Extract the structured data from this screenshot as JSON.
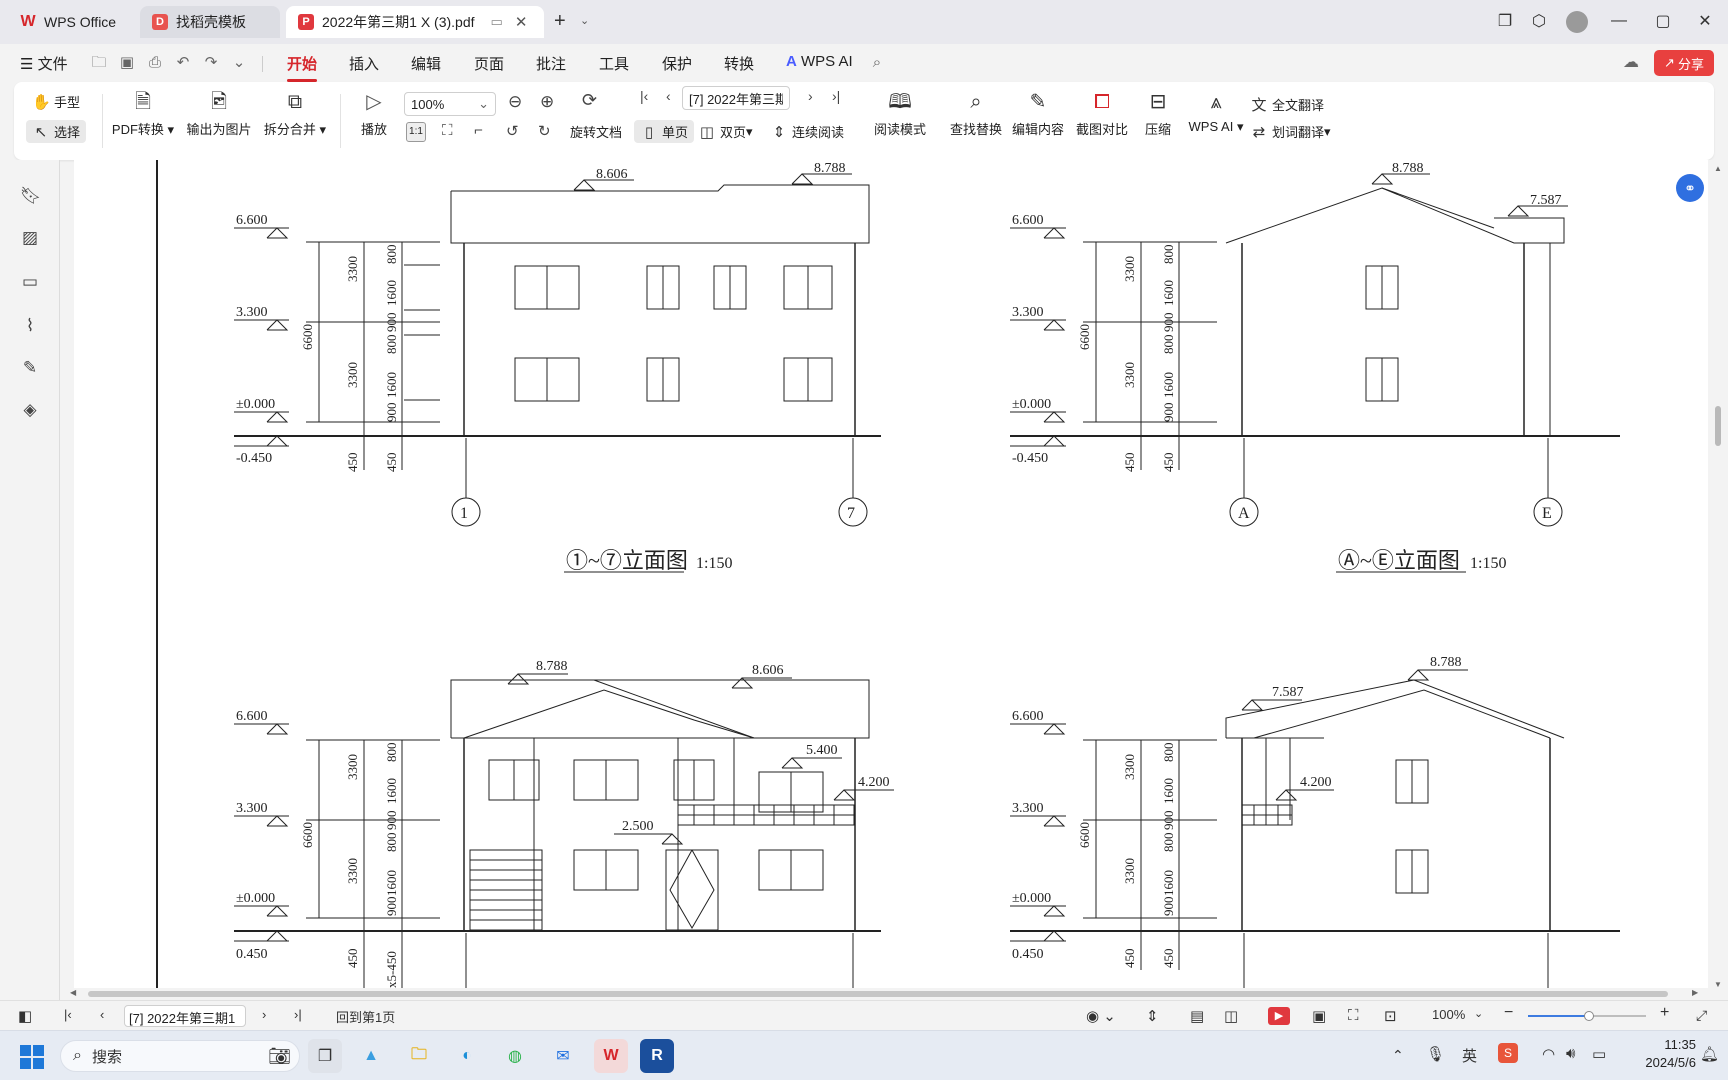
{
  "titlebar": {
    "tabs": [
      {
        "label": "WPS Office",
        "active": false
      },
      {
        "label": "找稻壳模板",
        "active": false
      },
      {
        "label": "2022年第三期1 X (3).pdf",
        "active": true
      }
    ],
    "new_tab": "+",
    "brand_color": "#d6262b"
  },
  "menubar": {
    "file": "文件",
    "items": [
      "开始",
      "插入",
      "编辑",
      "页面",
      "批注",
      "工具",
      "保护",
      "转换"
    ],
    "active": "开始",
    "wps_ai": "WPS AI",
    "share": "分享"
  },
  "ribbon": {
    "hand": "手型",
    "select": "选择",
    "pdf_convert": "PDF转换",
    "export_image": "输出为图片",
    "split_merge": "拆分合并",
    "play": "播放",
    "zoom": "100%",
    "page_field": "[7] 2022年第三期1",
    "rotate": "旋转文档",
    "single_page": "单页",
    "double_page": "双页",
    "continuous": "连续阅读",
    "reading_mode": "阅读模式",
    "find_replace": "查找替换",
    "edit_content": "编辑内容",
    "screenshot_compare": "截图对比",
    "compress": "压缩",
    "wps_ai": "WPS AI",
    "full_translate": "全文翻译",
    "word_translate": "划词翻译"
  },
  "drawing": {
    "tl": {
      "title": "①~⑦立面图",
      "scale": "1:150",
      "levels": [
        "6.600",
        "3.300",
        "±0.000",
        "-0.450"
      ],
      "tops": [
        "8.606",
        "8.788"
      ],
      "axis": [
        "1",
        "7"
      ],
      "dims": [
        "3300",
        "3300",
        "6600",
        "450",
        "450",
        "1600",
        "800",
        "1600",
        "900",
        "800",
        "900"
      ]
    },
    "tr": {
      "title": "Ⓐ~Ⓔ立面图",
      "scale": "1:150",
      "levels": [
        "6.600",
        "3.300",
        "±0.000",
        "-0.450"
      ],
      "tops": [
        "8.788",
        "7.587"
      ],
      "axis": [
        "A",
        "E"
      ],
      "dims": [
        "3300",
        "3300",
        "6600",
        "450",
        "450",
        "1600",
        "800",
        "1600",
        "900",
        "800",
        "900"
      ]
    },
    "bl": {
      "levels": [
        "6.600",
        "3.300",
        "±0.000",
        "0.450"
      ],
      "tops": [
        "8.788",
        "8.606"
      ],
      "marks": [
        "5.400",
        "4.200",
        "2.500"
      ],
      "dims": [
        "3300",
        "3300",
        "6600",
        "450",
        "1600",
        "800",
        "1600",
        "900",
        "800",
        "900",
        "x5-450"
      ]
    },
    "br": {
      "levels": [
        "6.600",
        "3.300",
        "±0.000",
        "0.450"
      ],
      "tops": [
        "8.788",
        "7.587"
      ],
      "marks": [
        "4.200"
      ],
      "dims": [
        "3300",
        "3300",
        "6600",
        "450",
        "450",
        "1600",
        "800",
        "1600",
        "900",
        "800",
        "900"
      ]
    }
  },
  "statusbar": {
    "page_field": "[7] 2022年第三期1",
    "back_first": "回到第1页",
    "zoom": "100%"
  },
  "taskbar": {
    "search": "搜索",
    "ime": "英",
    "time": "11:35",
    "date": "2024/5/6"
  }
}
